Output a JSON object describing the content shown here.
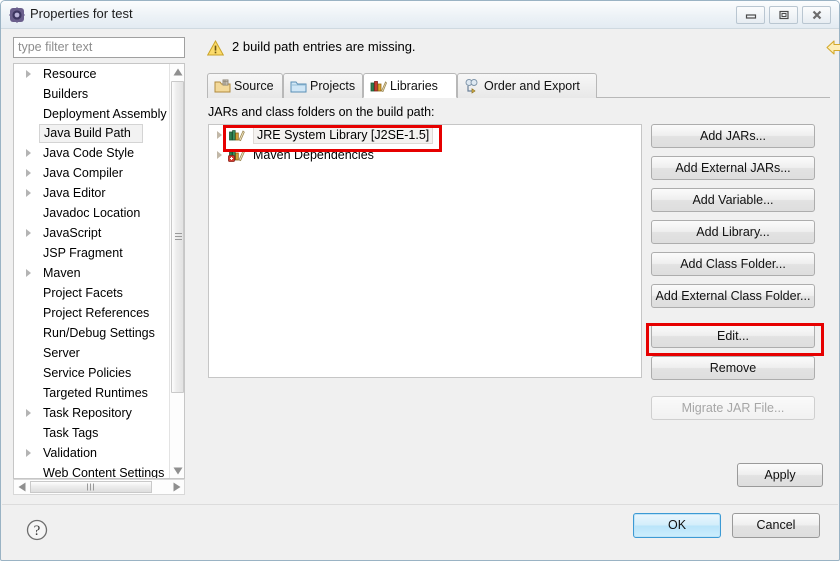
{
  "window": {
    "title": "Properties for test",
    "icon": "eclipse-properties-icon",
    "controls": {
      "minimize": "minimize-button",
      "maximize": "restore-button",
      "close": "close-button"
    }
  },
  "sidebar": {
    "filter": {
      "placeholder": "type filter text",
      "value": ""
    },
    "items": [
      {
        "label": "Resource",
        "expandable": true,
        "selected": false
      },
      {
        "label": "Builders",
        "expandable": false,
        "selected": false
      },
      {
        "label": "Deployment Assembly",
        "expandable": false,
        "selected": false
      },
      {
        "label": "Java Build Path",
        "expandable": false,
        "selected": true
      },
      {
        "label": "Java Code Style",
        "expandable": true,
        "selected": false
      },
      {
        "label": "Java Compiler",
        "expandable": true,
        "selected": false
      },
      {
        "label": "Java Editor",
        "expandable": true,
        "selected": false
      },
      {
        "label": "Javadoc Location",
        "expandable": false,
        "selected": false
      },
      {
        "label": "JavaScript",
        "expandable": true,
        "selected": false
      },
      {
        "label": "JSP Fragment",
        "expandable": false,
        "selected": false
      },
      {
        "label": "Maven",
        "expandable": true,
        "selected": false
      },
      {
        "label": "Project Facets",
        "expandable": false,
        "selected": false
      },
      {
        "label": "Project References",
        "expandable": false,
        "selected": false
      },
      {
        "label": "Run/Debug Settings",
        "expandable": false,
        "selected": false
      },
      {
        "label": "Server",
        "expandable": false,
        "selected": false
      },
      {
        "label": "Service Policies",
        "expandable": false,
        "selected": false
      },
      {
        "label": "Targeted Runtimes",
        "expandable": false,
        "selected": false
      },
      {
        "label": "Task Repository",
        "expandable": true,
        "selected": false
      },
      {
        "label": "Task Tags",
        "expandable": false,
        "selected": false
      },
      {
        "label": "Validation",
        "expandable": true,
        "selected": false
      },
      {
        "label": "Web Content Settings",
        "expandable": false,
        "selected": false
      }
    ]
  },
  "header": {
    "warning_icon": "warning-icon",
    "message": "2 build path entries are missing.",
    "nav": {
      "back_icon": "back-arrow-icon",
      "forward_icon": "forward-arrow-icon",
      "menu_icon": "dropdown-chevron-icon"
    }
  },
  "tabs": [
    {
      "label": "Source",
      "icon": "source-folder-icon",
      "active": false
    },
    {
      "label": "Projects",
      "icon": "projects-folder-icon",
      "active": false
    },
    {
      "label": "Libraries",
      "icon": "libraries-books-icon",
      "active": true
    },
    {
      "label": "Order and Export",
      "icon": "order-export-icon",
      "active": false
    }
  ],
  "main": {
    "caption": "JARs and class folders on the build path:",
    "entries": [
      {
        "label": "JRE System Library [J2SE-1.5]",
        "icon": "jre-library-icon",
        "expandable": true,
        "highlighted": true
      },
      {
        "label": "Maven Dependencies",
        "icon": "maven-library-icon",
        "expandable": true,
        "highlighted": false
      }
    ]
  },
  "side_buttons": [
    {
      "label": "Add JARs...",
      "enabled": true,
      "annotated": false
    },
    {
      "label": "Add External JARs...",
      "enabled": true,
      "annotated": false
    },
    {
      "label": "Add Variable...",
      "enabled": true,
      "annotated": false
    },
    {
      "label": "Add Library...",
      "enabled": true,
      "annotated": false
    },
    {
      "label": "Add Class Folder...",
      "enabled": true,
      "annotated": false
    },
    {
      "label": "Add External Class Folder...",
      "enabled": true,
      "annotated": false
    },
    {
      "label": "Edit...",
      "enabled": true,
      "annotated": true
    },
    {
      "label": "Remove",
      "enabled": true,
      "annotated": false
    },
    {
      "label": "Migrate JAR File...",
      "enabled": false,
      "annotated": false
    }
  ],
  "apply": {
    "label": "Apply"
  },
  "footer": {
    "help_icon": "help-question-icon",
    "ok": "OK",
    "cancel": "Cancel"
  },
  "colors": {
    "annotation": "#e60000",
    "default_button": "#b9e4fa",
    "warning": "#f0c419"
  }
}
